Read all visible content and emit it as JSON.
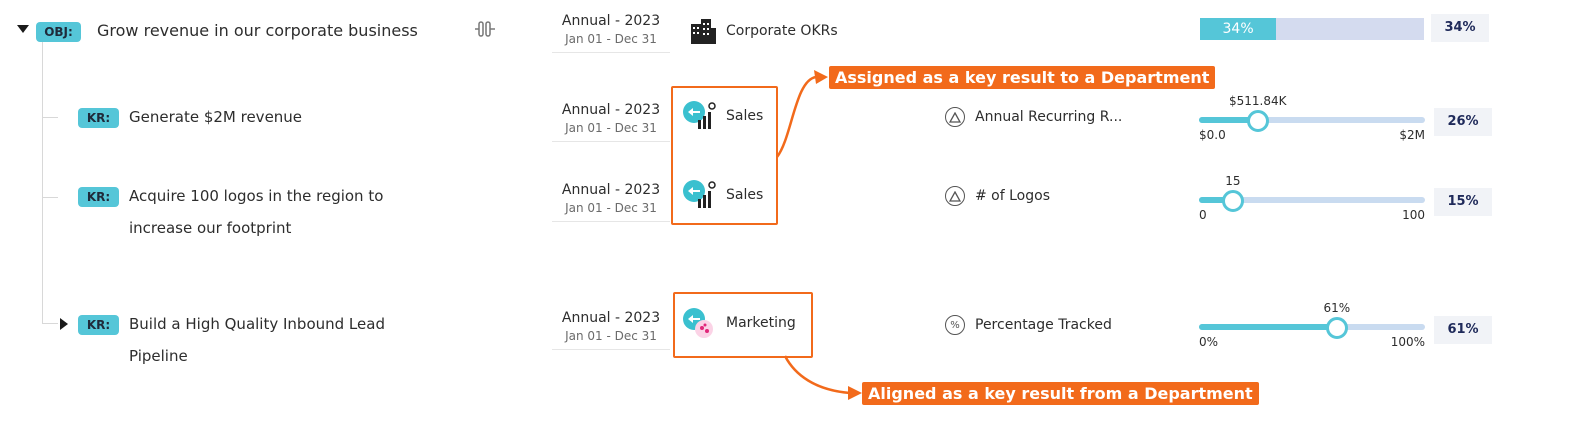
{
  "objective": {
    "chip": "OBJ:",
    "title": "Grow revenue in our corporate business",
    "period": "Annual - 2023",
    "dates": "Jan 01 - Dec 31",
    "owner": "Corporate OKRs",
    "progress_label": "34%",
    "progress_value": 34,
    "progress_pct": "34%"
  },
  "key_results": [
    {
      "chip": "KR:",
      "title_lines": [
        "Generate $2M revenue"
      ],
      "period": "Annual - 2023",
      "dates": "Jan 01 - Dec 31",
      "owner": "Sales",
      "metric": "Annual Recurring R...",
      "metric_icon": "triangle-icon",
      "current_label": "$511.84K",
      "min_label": "$0.0",
      "max_label": "$2M",
      "fraction": 0.26,
      "pct": "26%"
    },
    {
      "chip": "KR:",
      "title_lines": [
        "Acquire 100 logos in the region to",
        "increase our footprint"
      ],
      "period": "Annual - 2023",
      "dates": "Jan 01 - Dec 31",
      "owner": "Sales",
      "metric": "# of Logos",
      "metric_icon": "triangle-icon",
      "current_label": "15",
      "min_label": "0",
      "max_label": "100",
      "fraction": 0.15,
      "pct": "15%"
    },
    {
      "chip": "KR:",
      "title_lines": [
        "Build a High Quality Inbound Lead",
        "Pipeline"
      ],
      "period": "Annual - 2023",
      "dates": "Jan 01 - Dec 31",
      "owner": "Marketing",
      "metric": "Percentage Tracked",
      "metric_icon": "percent-icon",
      "current_label": "61%",
      "min_label": "0%",
      "max_label": "100%",
      "fraction": 0.61,
      "pct": "61%"
    }
  ],
  "callouts": {
    "assigned": "Assigned as a key result to a Department",
    "aligned": "Aligned as a key result from a Department"
  },
  "colors": {
    "accent": "#55c6d8",
    "callout": "#f26a1b",
    "progress_bg": "#d4dbef"
  }
}
